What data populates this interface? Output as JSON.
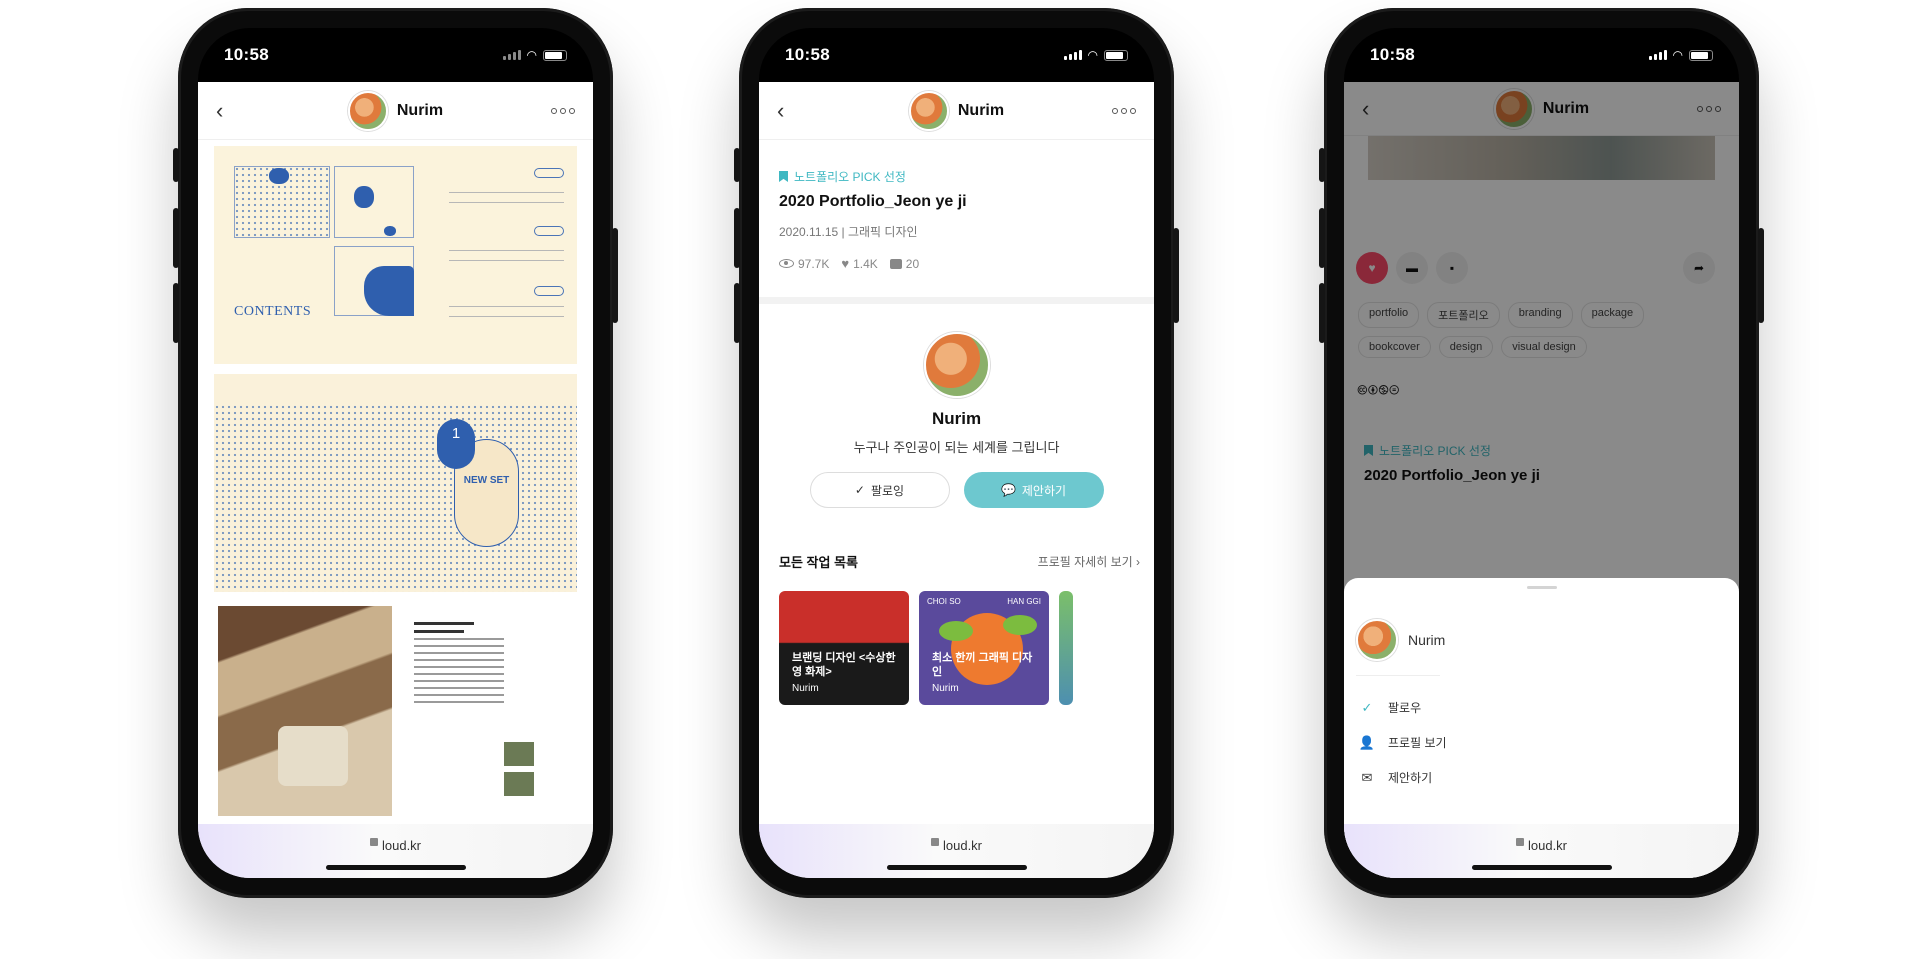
{
  "phones": [
    {
      "status_time": "10:58",
      "nav_username": "Nurim",
      "url": "loud.kr",
      "artwork": {
        "contents_title": "CONTENTS",
        "badge_number": "1",
        "new_set": "NEW SET"
      }
    },
    {
      "status_time": "10:58",
      "nav_username": "Nurim",
      "url": "loud.kr",
      "pick_label": "노트폴리오 PICK 선정",
      "post_title": "2020 Portfolio_Jeon ye ji",
      "post_meta": "2020.11.15 | 그래픽 디자인",
      "stats": {
        "views": "97.7K",
        "likes": "1.4K",
        "comments": "20"
      },
      "profile_name": "Nurim",
      "profile_bio": "누구나 주인공이 되는 세계를 그립니다",
      "follow_label": "팔로잉",
      "suggest_label": "제안하기",
      "works_title": "모든 작업 목록",
      "profile_link": "프로필 자세히 보기",
      "works": [
        {
          "title": "브랜딩 디자인 <수상한영 화제>",
          "author": "Nurim"
        },
        {
          "title": "최소 한끼 그래픽 디자인",
          "author": "Nurim",
          "top_left": "CHOI SO",
          "top_right": "HAN GGI"
        }
      ]
    },
    {
      "status_time": "10:58",
      "nav_username": "Nurim",
      "url": "loud.kr",
      "tags": [
        "portfolio",
        "포트폴리오",
        "branding",
        "package",
        "bookcover",
        "design",
        "visual design"
      ],
      "license_icons": "🅭🅯🄏⊜",
      "pick_label": "노트폴리오 PICK 선정",
      "post_title": "2020 Portfolio_Jeon ye ji",
      "sheet": {
        "username": "Nurim",
        "items": [
          {
            "icon": "check-icon",
            "label": "팔로우"
          },
          {
            "icon": "profile-icon",
            "label": "프로필 보기"
          },
          {
            "icon": "mail-icon",
            "label": "제안하기"
          }
        ]
      }
    }
  ]
}
